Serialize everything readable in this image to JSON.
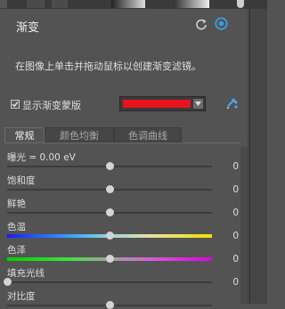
{
  "panel": {
    "title": "渐变",
    "instruction": "在图像上单击并拖动鼠标以创建渐变滤镜。",
    "show_mask_label": "显示渐变蒙版",
    "show_mask_checked": true,
    "mask_color": "#e8141b",
    "icons": [
      "refresh-icon",
      "toggle-on-icon",
      "dropdown-arrow-icon",
      "color-picker-swap-icon"
    ]
  },
  "tabs": [
    {
      "label": "常规",
      "active": true
    },
    {
      "label": "颜色均衡",
      "active": false
    },
    {
      "label": "色调曲线",
      "active": false
    }
  ],
  "sliders": [
    {
      "label": "曝光 = 0.00 eV",
      "value": "0",
      "position": 0.5,
      "track": "plain"
    },
    {
      "label": "饱和度",
      "value": "0",
      "position": 0.5,
      "track": "plain"
    },
    {
      "label": "鲜艳",
      "value": "0",
      "position": 0.5,
      "track": "plain"
    },
    {
      "label": "色温",
      "value": "0",
      "position": 0.5,
      "track": "temperature"
    },
    {
      "label": "色泽",
      "value": "0",
      "position": 0.5,
      "track": "tint"
    },
    {
      "label": "填充光线",
      "value": "0",
      "position": 0.0,
      "track": "plain"
    },
    {
      "label": "对比度",
      "value": "",
      "position": 0.5,
      "track": "plain"
    }
  ]
}
